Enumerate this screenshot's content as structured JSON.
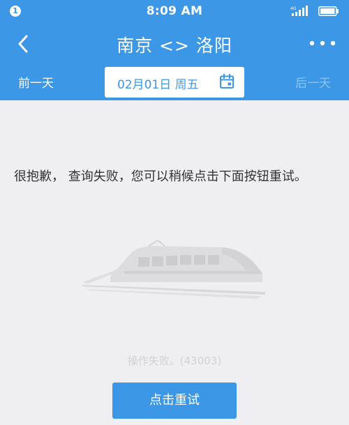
{
  "status_bar": {
    "notification_count": "1",
    "time": "8:09 AM",
    "network_label": "4G",
    "icons": [
      "signal-icon",
      "battery-icon"
    ]
  },
  "header": {
    "title": "南京 <> 洛阳",
    "back_icon": "chevron-left-icon",
    "more_icon": "more-dots-icon"
  },
  "date_bar": {
    "prev_label": "前一天",
    "date_value": "02月01日 周五",
    "next_label": "后一天",
    "calendar_icon": "calendar-icon"
  },
  "content": {
    "error_message": "很抱歉， 查询失败，您可以稍候点击下面按钮重试。",
    "error_code": "操作失败。(43003)",
    "retry_label": "点击重试",
    "illustration": "train-illustration"
  },
  "colors": {
    "brand_blue": "#3d97e7",
    "background": "#efeef3",
    "faded_text": "#d2d1d6"
  }
}
